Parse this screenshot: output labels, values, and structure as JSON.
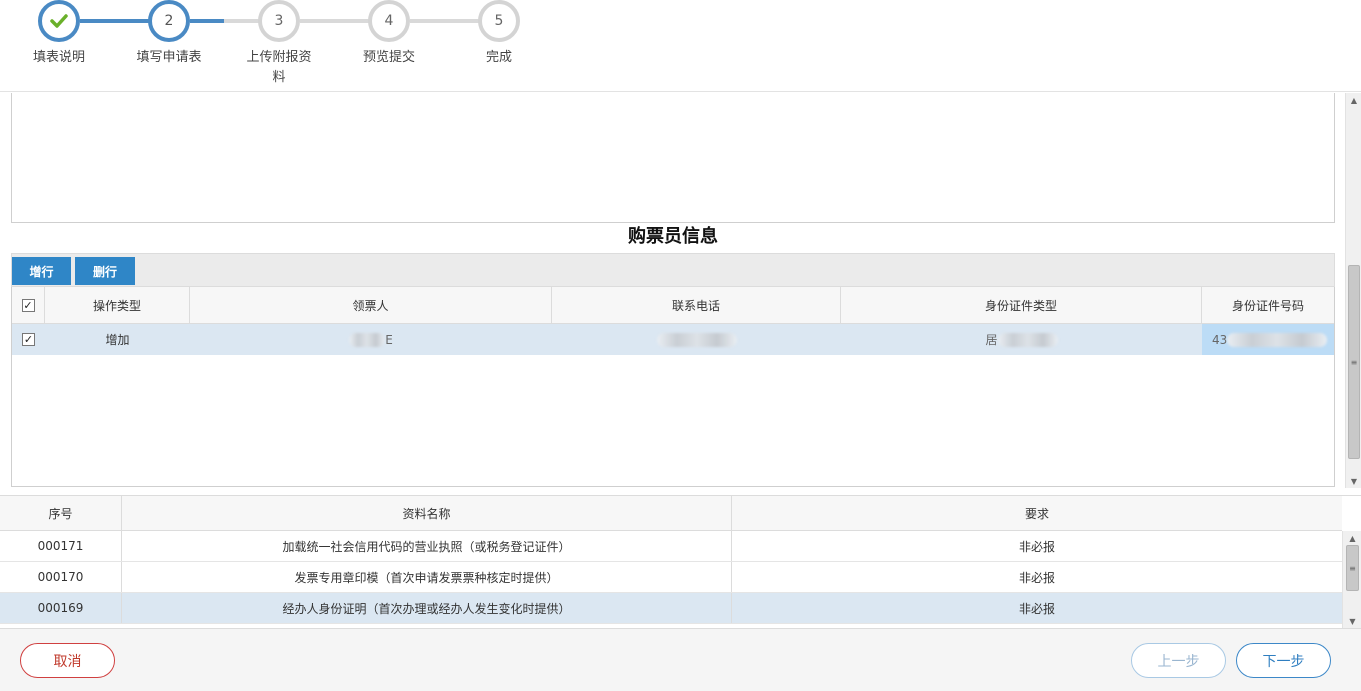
{
  "stepper": {
    "steps": [
      {
        "number": "",
        "label": "填表说明",
        "state": "done"
      },
      {
        "number": "2",
        "label": "填写申请表",
        "state": "active"
      },
      {
        "number": "3",
        "label": "上传附报资料",
        "state": "pending"
      },
      {
        "number": "4",
        "label": "预览提交",
        "state": "pending"
      },
      {
        "number": "5",
        "label": "完成",
        "state": "pending"
      }
    ],
    "colors": {
      "active": "#4a8ac4",
      "pending": "#d4d4d4",
      "check": "#6ab02a"
    }
  },
  "section": {
    "title": "购票员信息"
  },
  "toolbar": {
    "add_label": "增行",
    "delete_label": "删行"
  },
  "grid": {
    "headers": [
      "操作类型",
      "领票人",
      "联系电话",
      "身份证件类型",
      "身份证件号码"
    ],
    "rows": [
      {
        "checked": true,
        "operation": "增加",
        "name_visible": "E",
        "phone_visible": "",
        "id_type_visible": "居",
        "id_no_visible": "43"
      }
    ]
  },
  "materials": {
    "headers": [
      "序号",
      "资料名称",
      "要求"
    ],
    "rows": [
      {
        "seq": "000171",
        "name": "加载统一社会信用代码的营业执照（或税务登记证件）",
        "req": "非必报"
      },
      {
        "seq": "000170",
        "name": "发票专用章印模（首次申请发票票种核定时提供）",
        "req": "非必报"
      },
      {
        "seq": "000169",
        "name": "经办人身份证明（首次办理或经办人发生变化时提供）",
        "req": "非必报"
      }
    ]
  },
  "footer": {
    "cancel_label": "取消",
    "prev_label": "上一步",
    "next_label": "下一步"
  }
}
